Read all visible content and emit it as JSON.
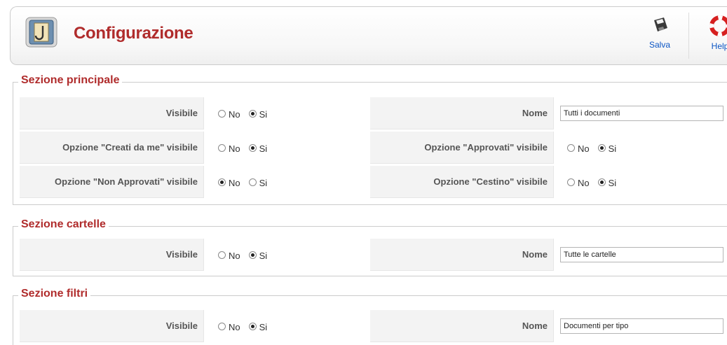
{
  "header": {
    "title": "Configurazione",
    "save_label": "Salva",
    "help_label": "Help"
  },
  "colors": {
    "title": "#b02c2c",
    "toolbar_link": "#0b55c4",
    "label_bg": "#f3f3f3"
  },
  "sections": {
    "principale": {
      "legend": "Sezione principale",
      "rows": [
        {
          "left_label": "Visibile",
          "left_selected": "Si",
          "right_label": "Nome",
          "right_value": "Tutti i documenti"
        },
        {
          "left_label": "Opzione \"Creati da me\" visibile",
          "left_selected": "Si",
          "right_label": "Opzione \"Approvati\" visibile",
          "right_selected": "Si"
        },
        {
          "left_label": "Opzione \"Non Approvati\" visibile",
          "left_selected": "No",
          "right_label": "Opzione \"Cestino\" visibile",
          "right_selected": "Si"
        }
      ]
    },
    "cartelle": {
      "legend": "Sezione cartelle",
      "rows": [
        {
          "left_label": "Visibile",
          "left_selected": "Si",
          "right_label": "Nome",
          "right_value": "Tutte le cartelle"
        }
      ]
    },
    "filtri": {
      "legend": "Sezione filtri",
      "rows": [
        {
          "left_label": "Visibile",
          "left_selected": "Si",
          "right_label": "Nome",
          "right_value": "Documenti per tipo"
        }
      ]
    }
  },
  "options": {
    "no": "No",
    "si": "Si"
  }
}
